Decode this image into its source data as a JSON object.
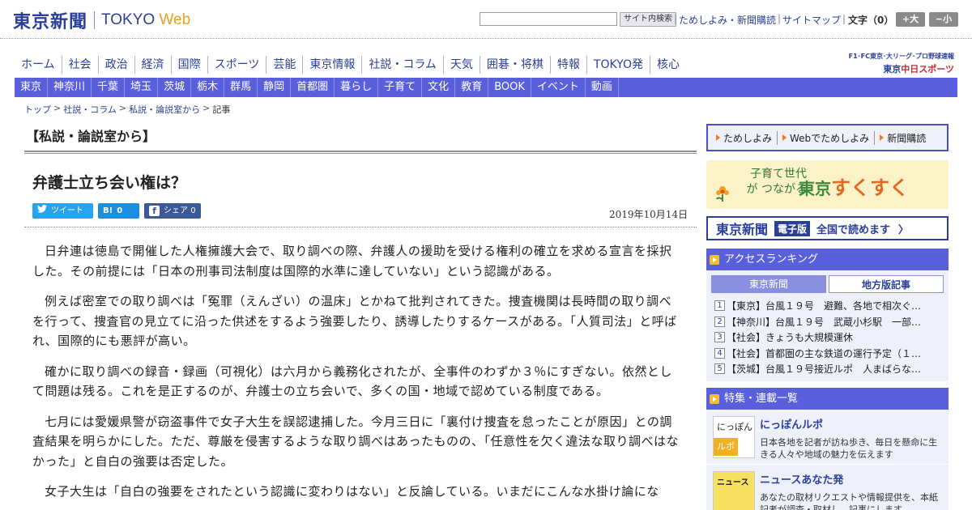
{
  "header": {
    "logo_jp": "東京新聞",
    "logo_en_main": "TOKYO",
    "logo_en_accent": "Web",
    "search_button": "サイト内検索",
    "link_tameshi": "ためしよみ・新聞購読",
    "link_sitemap": "サイトマップ",
    "font_size_label": "文字（0）",
    "font_up": "+大",
    "font_down": "−小"
  },
  "main_nav": [
    "ホーム",
    "社会",
    "政治",
    "経済",
    "国際",
    "スポーツ",
    "芸能",
    "東京情報",
    "社説・コラム",
    "天気",
    "囲碁・将棋",
    "特報",
    "TOKYO発",
    "核心"
  ],
  "chunichi": {
    "top": "F1･FC東京･大リーグ･プロ野球速報",
    "logo_prefix": "東京",
    "logo_main": "中日スポーツ"
  },
  "region_nav": [
    "東京",
    "神奈川",
    "千葉",
    "埼玉",
    "茨城",
    "栃木",
    "群馬",
    "静岡",
    "首都圏",
    "暮らし",
    "子育て",
    "文化",
    "教育",
    "BOOK",
    "イベント",
    "動画"
  ],
  "breadcrumb": {
    "items": [
      "トップ",
      "社説・コラム",
      "私説・論説室から"
    ],
    "current": "記事",
    "sep": ">"
  },
  "section_title": "【私説・論説室から】",
  "article": {
    "title": "弁護士立ち会い権は？",
    "date": "2019年10月14日",
    "share": {
      "tweet": "ツイート",
      "hatena_b": "B!",
      "hatena_count": "0",
      "fb_label": "シェア",
      "fb_count": "0"
    },
    "paragraphs": [
      "日弁連は徳島で開催した人権擁護大会で、取り調べの際、弁護人の援助を受ける権利の確立を求める宣言を採択した。その前提には「日本の刑事司法制度は国際的水準に達していない」という認識がある。",
      "例えば密室での取り調べは「冤罪（えんざい）の温床」とかねて批判されてきた。捜査機関は長時間の取り調べを行って、捜査官の見立てに沿った供述をするよう強要したり、誘導したりするケースがある。「人質司法」と呼ばれ、国際的にも悪評が高い。",
      "確かに取り調べの録音・録画（可視化）は六月から義務化されたが、全事件のわずか３％にすぎない。依然として問題は残る。これを是正するのが、弁護士の立ち会いで、多くの国・地域で認めている制度である。",
      "七月には愛媛県警が窃盗事件で女子大生を誤認逮捕した。今月三日に「裏付け捜査を怠ったことが原因」との調査結果を明らかにした。ただ、尊厳を侵害するような取り調べはあったものの、「任意性を欠く違法な取り調べはなかった」と自白の強要は否定した。",
      "女子大生は「自白の強要をされたという認識に変わりはない」と反論している。いまだにこんな水掛け論にな"
    ]
  },
  "sidebar": {
    "links": [
      "ためしよみ",
      "Webでためしよみ",
      "新聞購読"
    ],
    "sukusuku_sub": "子育て世代が つながる",
    "sukusuku_title_a": "東京",
    "sukusuku_title_b": "すくすく",
    "eban_logo": "東京新聞",
    "eban_tag": "電子版",
    "eban_text": "全国で読めます",
    "eban_arrow": "〉",
    "ranking": {
      "title": "アクセスランキング",
      "tab_tokyo": "東京新聞",
      "tab_local": "地方版記事",
      "items": [
        {
          "num": "1",
          "text": "【東京】台風１９号　避難、各地で相次ぐ…"
        },
        {
          "num": "2",
          "text": "【神奈川】台風１９号　武蔵小杉駅　一部…"
        },
        {
          "num": "3",
          "text": "【社会】きょうも大規模運休"
        },
        {
          "num": "4",
          "text": "【社会】首都圏の主な鉄道の運行予定（１…"
        },
        {
          "num": "5",
          "text": "【茨城】台風１９号接近ルポ　人まばらな…"
        }
      ]
    },
    "features": {
      "title": "特集・連載一覧",
      "items": [
        {
          "thumb_a": "にっぽん",
          "thumb_b": "ルポ",
          "title": "にっぽんルポ",
          "desc": "日本各地を記者が訪ね歩き、毎日を懸命に生きる人々や地域の魅力を伝えます"
        },
        {
          "thumb_a": "ニュース",
          "title": "ニュースあなた発",
          "desc": "あなたの取材リクエストや情報提供を、本紙記者が調査・取材し、記事にします"
        }
      ]
    }
  },
  "colors": {
    "brand_blue": "#2a3f9a",
    "nav_purple": "#5a5fdc",
    "accent_orange": "#e8a020"
  }
}
